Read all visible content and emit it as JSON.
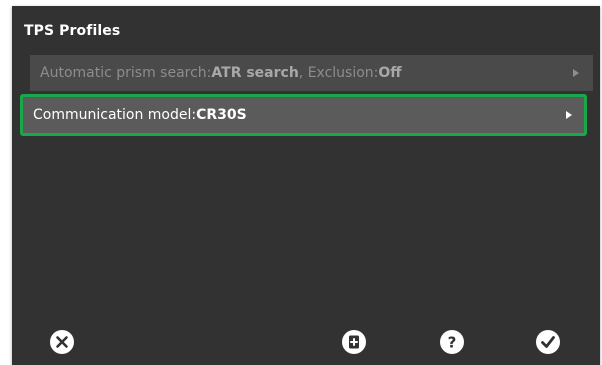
{
  "header": {
    "title": "TPS Profiles"
  },
  "rows": [
    {
      "prefix": "Automatic prism search: ",
      "value1": "ATR search",
      "middle": " , Exclusion: ",
      "value2": "Off"
    },
    {
      "prefix": "Communication model: ",
      "value": "CR30S"
    }
  ],
  "footer": {
    "icons": [
      "close-icon",
      "add-icon",
      "help-icon",
      "confirm-icon"
    ]
  },
  "colors": {
    "background": "#323233",
    "row": "#4a4a4b",
    "selected_border": "#17a84b"
  }
}
